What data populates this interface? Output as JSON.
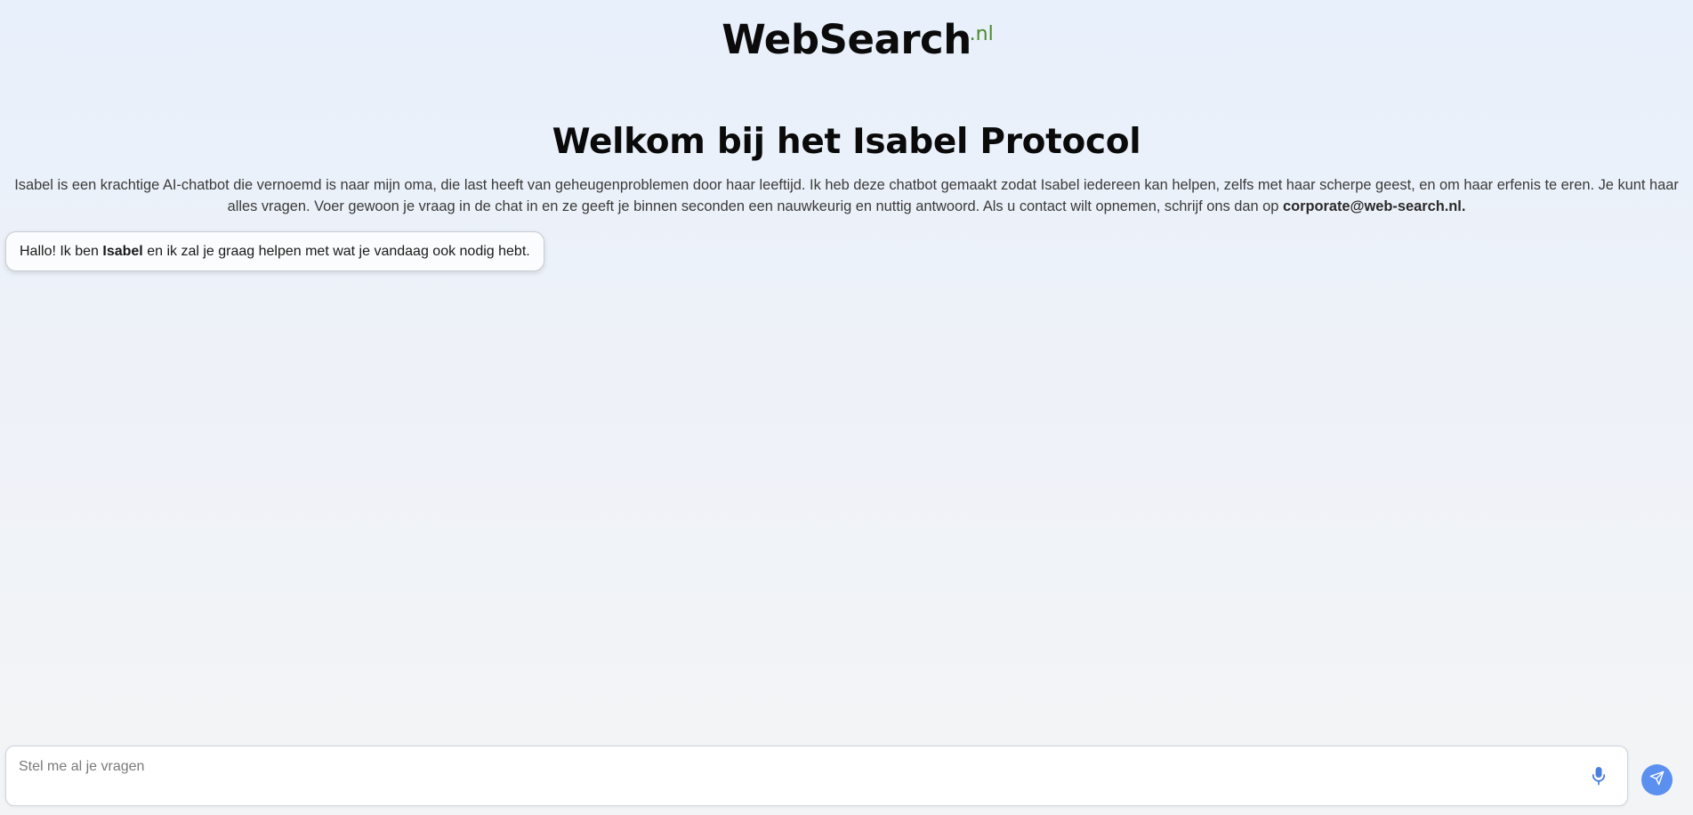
{
  "header": {
    "logo_text": "WebSearch",
    "logo_tld": ".nl"
  },
  "main": {
    "title": "Welkom bij het Isabel Protocol",
    "intro_text": "Isabel is een krachtige AI-chatbot die vernoemd is naar mijn oma, die last heeft van geheugenproblemen door haar leeftijd. Ik heb deze chatbot gemaakt zodat Isabel iedereen kan helpen, zelfs met haar scherpe geest, en om haar erfenis te eren. Je kunt haar alles vragen. Voer gewoon je vraag in de chat in en ze geeft je binnen seconden een nauwkeurig en nuttig antwoord. Als u contact wilt opnemen, schrijf ons dan op ",
    "contact_email": "corporate@web-search.nl."
  },
  "chat": {
    "messages": [
      {
        "sender": "bot",
        "text_before": "Hallo! Ik ben ",
        "text_bold": "Isabel",
        "text_after": " en ik zal je graag helpen met wat je vandaag ook nodig hebt."
      }
    ]
  },
  "input": {
    "placeholder": "Stel me al je vragen",
    "value": ""
  },
  "icons": {
    "mic": "microphone-icon",
    "send": "send-icon"
  },
  "colors": {
    "logo_tld": "#4a8a2a",
    "accent": "#5b8ff0",
    "mic_icon": "#4a7fe0"
  }
}
